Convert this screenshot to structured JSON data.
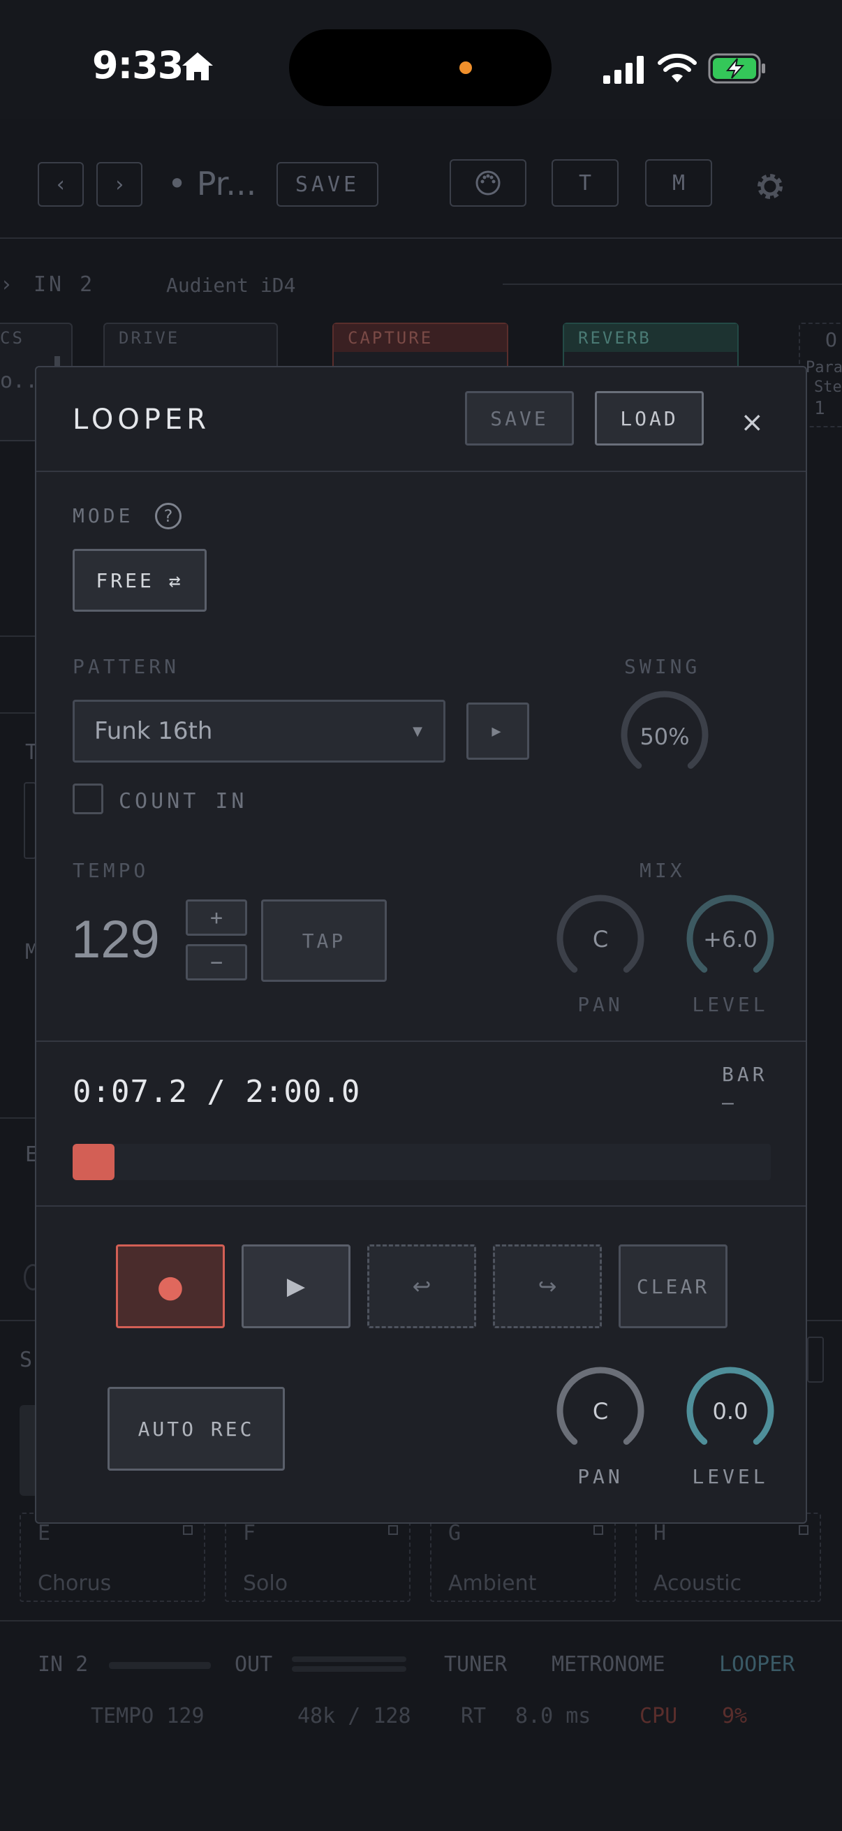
{
  "status_bar": {
    "time": "9:33"
  },
  "background_app": {
    "header": {
      "prev": "‹",
      "next": "›",
      "preset_name": "• Pr...",
      "save": "SAVE",
      "t": "T",
      "m": "M"
    },
    "input_row": {
      "input": "IN 2",
      "device": "Audient iD4"
    },
    "pedals": {
      "cs": "CS",
      "cs_val": "o...",
      "drive": "DRIVE",
      "capture": "CAPTURE",
      "reverb": "REVERB",
      "right_top": "O",
      "right_a": "Para",
      "right_b": "Ste",
      "right_c": "1"
    },
    "side_letters": {
      "t": "T",
      "m": "M",
      "e": "E",
      "s": "S"
    },
    "scenes": [
      {
        "letter": "E",
        "name": "Chorus"
      },
      {
        "letter": "F",
        "name": "Solo"
      },
      {
        "letter": "G",
        "name": "Ambient"
      },
      {
        "letter": "H",
        "name": "Acoustic"
      }
    ],
    "bottom_bar": {
      "in": "IN 2",
      "out": "OUT",
      "tuner": "TUNER",
      "metronome": "METRONOME",
      "looper": "LOOPER",
      "tempo": "TEMPO 129",
      "rate": "48k / 128",
      "rt_label": "RT",
      "rt_value": "8.0 ms",
      "cpu_label": "CPU",
      "cpu_value": "9%"
    }
  },
  "looper": {
    "title": "LOOPER",
    "save": "SAVE",
    "load": "LOAD",
    "close": "×",
    "mode": {
      "label": "MODE",
      "help": "?",
      "value": "FREE ⇄"
    },
    "pattern": {
      "label": "PATTERN",
      "selected": "Funk 16th",
      "arrow": "▼",
      "play": "▶"
    },
    "swing": {
      "label": "SWING",
      "value": "50%",
      "level": 0.5
    },
    "count_in": {
      "label": "COUNT IN",
      "checked": false
    },
    "tempo": {
      "label": "TEMPO",
      "value": "129",
      "plus": "+",
      "minus": "−",
      "tap": "TAP"
    },
    "mix": {
      "label": "MIX",
      "pan_value": "C",
      "pan_label": "PAN",
      "level_value": "+6.0",
      "level_label": "LEVEL"
    },
    "position": {
      "readout": "0:07.2 / 2:00.0",
      "bar_label": "BAR",
      "bar_value": "—",
      "progress": 0.06
    },
    "transport": {
      "record": "●",
      "play": "▶",
      "undo": "↩",
      "redo": "↪",
      "clear": "CLEAR"
    },
    "auto_rec": "AUTO REC",
    "output": {
      "pan_value": "C",
      "pan_label": "PAN",
      "level_value": "0.0",
      "level_label": "LEVEL"
    }
  },
  "colors": {
    "record": "#d35f55",
    "accent_teal": "#4f8f9a",
    "battery": "#34c759"
  }
}
